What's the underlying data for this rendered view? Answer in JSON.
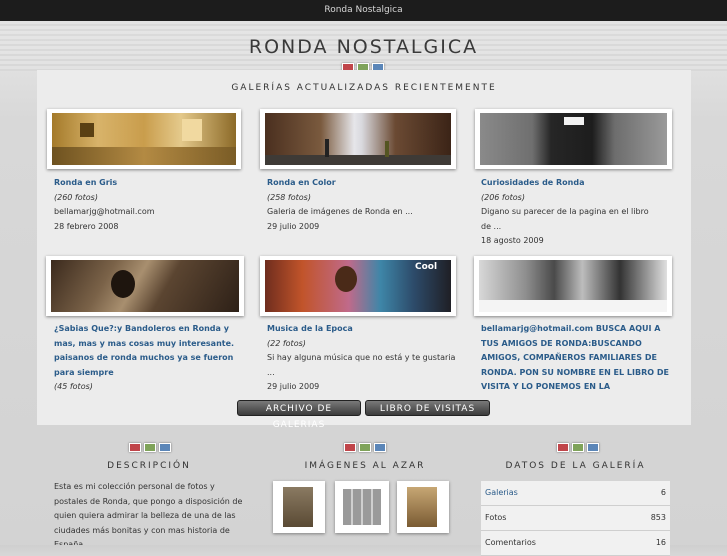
{
  "window_title": "Ronda Nostalgica",
  "site_title": "RONDA NOSTALGICA",
  "swatch_colors": [
    "#c0454a",
    "#7fa35a",
    "#5b86b8"
  ],
  "recent": {
    "heading": "GALERÍAS ACTUALIZADAS RECIENTEMENTE",
    "cards": [
      {
        "title": "Ronda en Gris",
        "count": "(260 fotos)",
        "line1": "bellamarjg@hotmail.com",
        "line2": "28 febrero 2008",
        "line3": ""
      },
      {
        "title": "Ronda en Color",
        "count": "(258 fotos)",
        "line1": "Galeria de imágenes de Ronda en ...",
        "line2": "29 julio 2009",
        "line3": ""
      },
      {
        "title": "Curiosidades de Ronda",
        "count": "(206 fotos)",
        "line1": "Digano su parecer de la pagina en el libro",
        "line2": "de ...",
        "line3": "18 agosto 2009"
      },
      {
        "title": "¿Sabias Que?:y Bandoleros en Ronda y mas, mas y mas cosas muy interesante. paisanos de ronda muchos ya se fueron para siempre",
        "count": "(45 fotos)",
        "line1": "",
        "line2": "",
        "line3": ""
      },
      {
        "title": "Musica de la Epoca",
        "count": "(22 fotos)",
        "line1": "Si hay alguna música que no está y te gustaria ...",
        "line2": "29 julio 2009",
        "line3": ""
      },
      {
        "title": "bellamarjg@hotmail.com BUSCA AQUI A TUS AMIGOS DE RONDA:BUSCANDO AMIGOS, COMPAÑEROS FAMILIARES DE RONDA. PON SU NOMBRE EN EL LIBRO DE VISITA Y LO PONEMOS EN LA",
        "count": "",
        "line1": "",
        "line2": "",
        "line3": ""
      }
    ]
  },
  "buttons": {
    "archive": "ARCHIVO DE GALERIAS",
    "guestbook": "LIBRO DE VISITAS"
  },
  "description": {
    "heading": "DESCRIPCIÓN",
    "text": "Esta es mi colección personal de fotos y postales de Ronda, que pongo a disposición de quien quiera admirar la belleza de una de las ciudades más bonitas y con mas historia de España."
  },
  "random": {
    "heading": "IMÁGENES AL AZAR"
  },
  "stats": {
    "heading": "DATOS DE LA GALERÍA",
    "rows": [
      {
        "label": "Galerias",
        "value": "6"
      },
      {
        "label": "Fotos",
        "value": "853"
      },
      {
        "label": "Comentarios",
        "value": "16"
      }
    ]
  }
}
